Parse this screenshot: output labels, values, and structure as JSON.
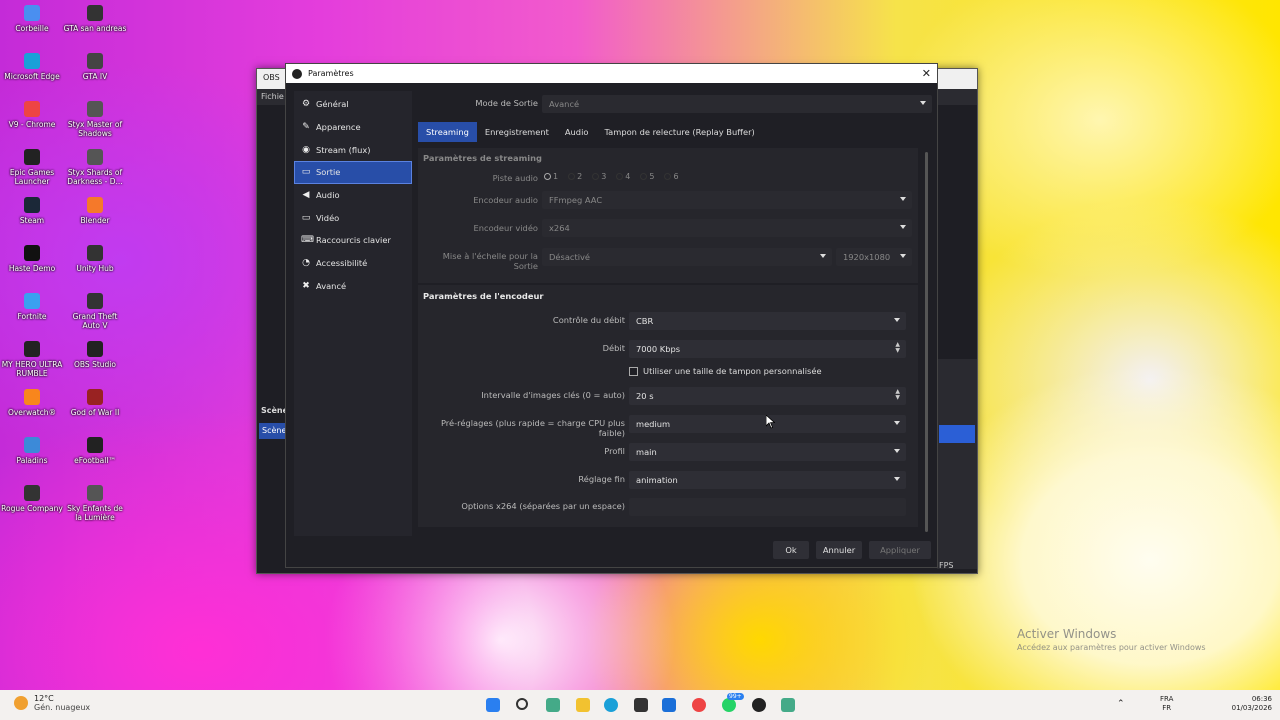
{
  "desktop": {
    "icons": [
      {
        "label": "Corbeille",
        "color": "#4a8ff0"
      },
      {
        "label": "GTA san andreas",
        "color": "#333"
      },
      {
        "label": "Microsoft Edge",
        "color": "#1aa0d8"
      },
      {
        "label": "GTA IV",
        "color": "#444"
      },
      {
        "label": "V9 - Chrome",
        "color": "#e44"
      },
      {
        "label": "Styx Master of Shadows",
        "color": "#555"
      },
      {
        "label": "Epic Games Launcher",
        "color": "#222"
      },
      {
        "label": "Styx Shards of Darkness - D...",
        "color": "#555"
      },
      {
        "label": "Steam",
        "color": "#1b2838"
      },
      {
        "label": "Blender",
        "color": "#f5792a"
      },
      {
        "label": "Haste Demo",
        "color": "#111"
      },
      {
        "label": "Unity Hub",
        "color": "#333"
      },
      {
        "label": "Fortnite",
        "color": "#3aa0f0"
      },
      {
        "label": "Grand Theft Auto V",
        "color": "#333"
      },
      {
        "label": "MY HERO ULTRA RUMBLE",
        "color": "#222"
      },
      {
        "label": "OBS Studio",
        "color": "#222"
      },
      {
        "label": "Overwatch®",
        "color": "#f8861c"
      },
      {
        "label": "God of War II",
        "color": "#922"
      },
      {
        "label": "Paladins",
        "color": "#3c8ad8"
      },
      {
        "label": "eFootball™",
        "color": "#222"
      },
      {
        "label": "Rogue Company",
        "color": "#333"
      },
      {
        "label": "Sky Enfants de la Lumière",
        "color": "#555"
      }
    ]
  },
  "obs_window": {
    "title": "OBS",
    "menu_first": "Fichie",
    "scenes_label": "Scène",
    "scenes_item": "Scène",
    "fps_text": "FPS"
  },
  "dialog": {
    "title": "Paramètres",
    "close": "✕",
    "sidebar": [
      {
        "label": "Général",
        "icon": "⚙"
      },
      {
        "label": "Apparence",
        "icon": "✎"
      },
      {
        "label": "Stream (flux)",
        "icon": "◉"
      },
      {
        "label": "Sortie",
        "icon": "▭"
      },
      {
        "label": "Audio",
        "icon": "◀"
      },
      {
        "label": "Vidéo",
        "icon": "▭"
      },
      {
        "label": "Raccourcis clavier",
        "icon": "⌨"
      },
      {
        "label": "Accessibilité",
        "icon": "◔"
      },
      {
        "label": "Avancé",
        "icon": "✖"
      }
    ],
    "output_mode_label": "Mode de Sortie",
    "output_mode_value": "Avancé",
    "tabs": [
      "Streaming",
      "Enregistrement",
      "Audio",
      "Tampon de relecture (Replay Buffer)"
    ],
    "streaming_group": {
      "title": "Paramètres de streaming",
      "audio_track_label": "Piste audio",
      "tracks": [
        "1",
        "2",
        "3",
        "4",
        "5",
        "6"
      ],
      "audio_encoder_label": "Encodeur audio",
      "audio_encoder_value": "FFmpeg AAC",
      "video_encoder_label": "Encodeur vidéo",
      "video_encoder_value": "x264",
      "rescale_label": "Mise à l'échelle pour la Sortie",
      "rescale_value": "Désactivé",
      "rescale_res": "1920x1080"
    },
    "encoder_group": {
      "title": "Paramètres de l'encodeur",
      "rate_control_label": "Contrôle du débit",
      "rate_control_value": "CBR",
      "bitrate_label": "Débit",
      "bitrate_value": "7000 Kbps",
      "custom_buffer_label": "Utiliser une taille de tampon personnalisée",
      "keyframe_label": "Intervalle d'images clés (0 = auto)",
      "keyframe_value": "20 s",
      "preset_label": "Pré-réglages (plus rapide = charge CPU plus faible)",
      "preset_value": "medium",
      "profile_label": "Profil",
      "profile_value": "main",
      "tune_label": "Réglage fin",
      "tune_value": "animation",
      "x264_opts_label": "Options x264 (séparées par un espace)",
      "x264_opts_value": ""
    },
    "buttons": {
      "ok": "Ok",
      "cancel": "Annuler",
      "apply": "Appliquer"
    }
  },
  "watermark": {
    "title": "Activer Windows",
    "subtitle": "Accédez aux paramètres pour activer Windows"
  },
  "taskbar": {
    "weather_temp": "12°C",
    "weather_desc": "Gén. nuageux",
    "lang_top": "FRA",
    "lang_bottom": "FR",
    "time": "06:36",
    "date": "01/03/2026",
    "badge": "99+"
  }
}
